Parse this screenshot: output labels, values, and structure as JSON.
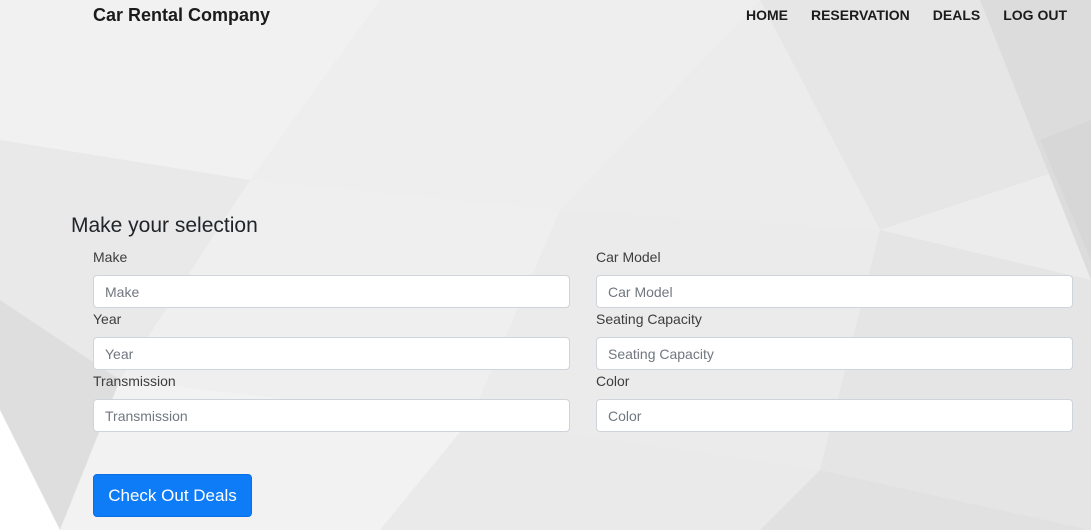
{
  "colors": {
    "background": "#ececec",
    "primary_button": "#0f7cf7",
    "text": "#212529"
  },
  "navbar": {
    "brand": "Car Rental Company",
    "links": [
      "HOME",
      "RESERVATION",
      "DEALS",
      "LOG OUT"
    ]
  },
  "form": {
    "heading": "Make your selection",
    "fields": [
      {
        "label": "Make",
        "placeholder": "Make",
        "value": ""
      },
      {
        "label": "Car Model",
        "placeholder": "Car Model",
        "value": ""
      },
      {
        "label": "Year",
        "placeholder": "Year",
        "value": ""
      },
      {
        "label": "Seating Capacity",
        "placeholder": "Seating Capacity",
        "value": ""
      },
      {
        "label": "Transmission",
        "placeholder": "Transmission",
        "value": ""
      },
      {
        "label": "Color",
        "placeholder": "Color",
        "value": ""
      }
    ],
    "submit_label": "Check Out Deals"
  }
}
